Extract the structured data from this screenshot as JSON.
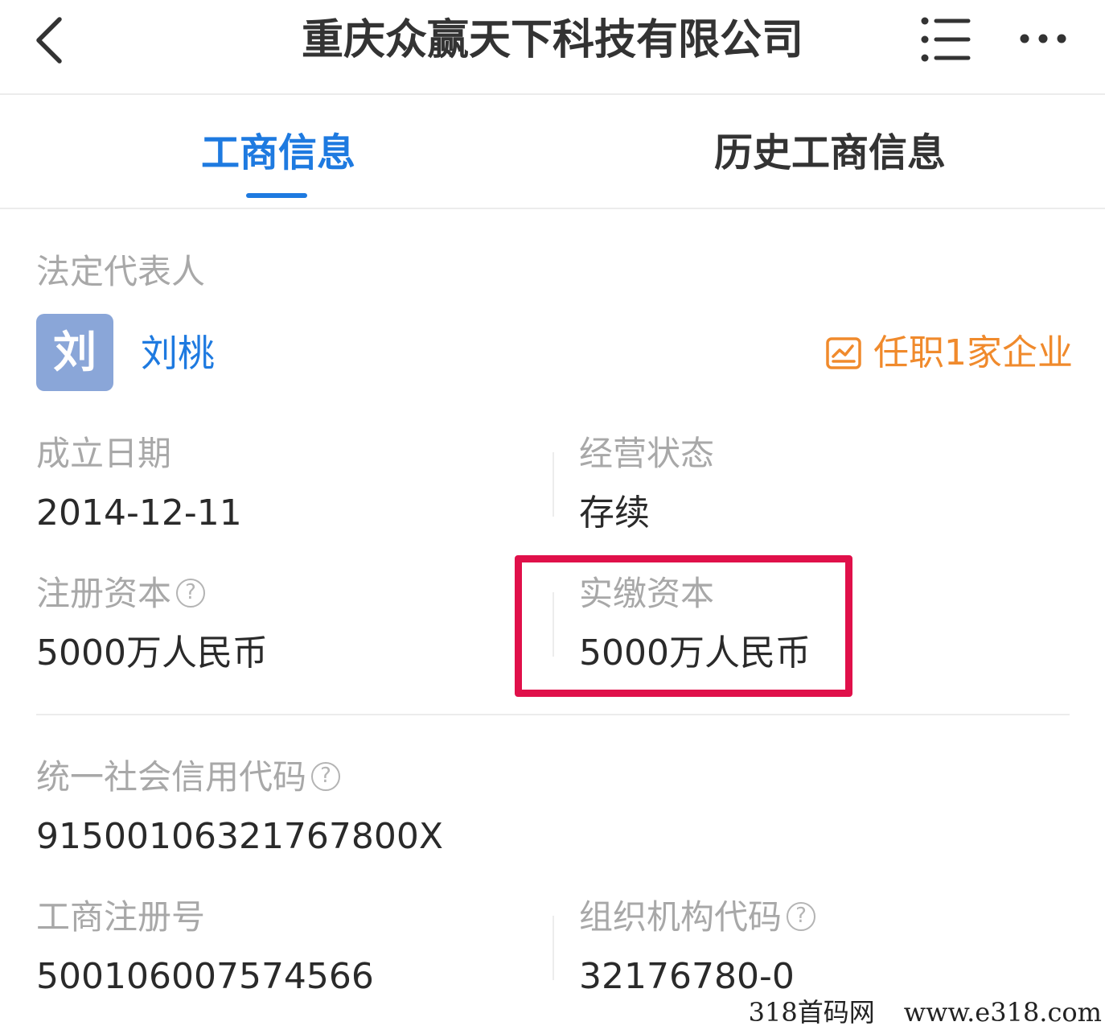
{
  "header": {
    "title": "重庆众赢天下科技有限公司",
    "back_icon": "chevron-left-icon",
    "list_icon": "list-icon",
    "more_icon": "more-horizontal-icon"
  },
  "tabs": [
    {
      "label": "工商信息",
      "active": true
    },
    {
      "label": "历史工商信息",
      "active": false
    }
  ],
  "legal_rep": {
    "label": "法定代表人",
    "avatar_char": "刘",
    "name": "刘桃",
    "positions_icon": "chart-icon",
    "positions_text": "任职1家企业"
  },
  "fields": {
    "established": {
      "label": "成立日期",
      "value": "2014-12-11"
    },
    "status": {
      "label": "经营状态",
      "value": "存续"
    },
    "registered_capital": {
      "label": "注册资本",
      "value": "5000万人民币",
      "help": "?"
    },
    "paid_capital": {
      "label": "实缴资本",
      "value": "5000万人民币"
    },
    "credit_code": {
      "label": "统一社会信用代码",
      "value": "91500106321767800X",
      "help": "?"
    },
    "reg_number": {
      "label": "工商注册号",
      "value": "500106007574566"
    },
    "org_code": {
      "label": "组织机构代码",
      "value": "32176780-0",
      "help": "?"
    }
  },
  "watermark": {
    "site_name": "318首码网",
    "url": "www.e318.com"
  },
  "colors": {
    "accent": "#1e7ae0",
    "orange": "#f08a2c",
    "highlight": "#e0104a",
    "avatar_bg": "#8aa6d8",
    "label_gray": "#a8a8a8"
  }
}
